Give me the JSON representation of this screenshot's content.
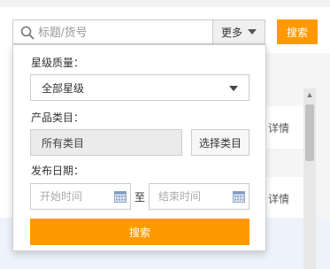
{
  "search": {
    "placeholder": "标题/货号",
    "more_label": "更多",
    "search_button": "搜索"
  },
  "filters": {
    "star_label": "星级质量：",
    "star_selected": "全部星级",
    "category_label": "产品类目：",
    "category_value": "所有类目",
    "category_button": "选择类目",
    "date_label": "发布日期：",
    "start_placeholder": "开始时间",
    "to_label": "至",
    "end_placeholder": "结束时间",
    "submit_label": "搜索"
  },
  "list": {
    "rows": [
      "详情",
      "详情"
    ]
  },
  "colors": {
    "accent": "#ff9900",
    "border": "#cccccc"
  },
  "icons": [
    "search-icon",
    "chevron-down-icon",
    "calendar-icon"
  ]
}
